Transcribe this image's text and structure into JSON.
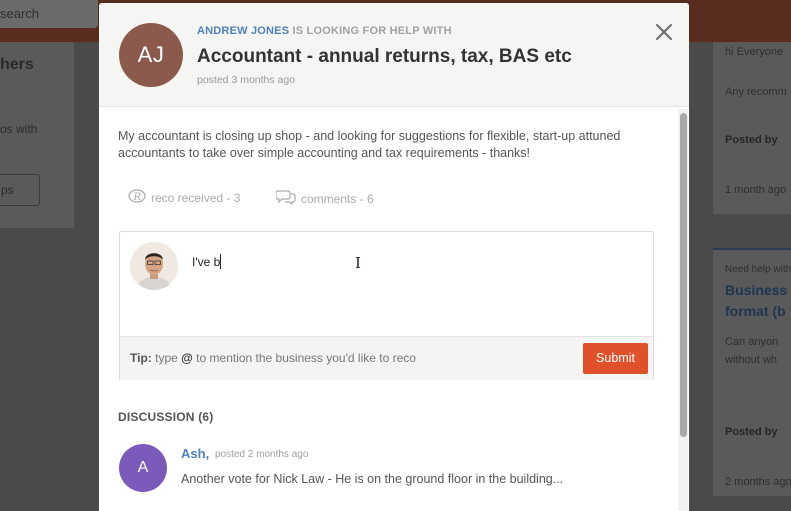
{
  "background": {
    "search_text": "search",
    "left_heading": "hers",
    "left_text": "os with",
    "left_button": "ps",
    "right_text_1": "hi Everyone",
    "right_text_2": "Any recomm",
    "right_posted_by_1": "Posted by",
    "right_time_1": "1 month ago",
    "right_need_help": "Need help with",
    "right_title_1": "Business",
    "right_title_2": "format (b",
    "right_text_3": "Can anyon",
    "right_text_4": "without wh",
    "right_posted_by_2": "Posted by",
    "right_time_2": "2 months ago"
  },
  "modal": {
    "avatar_initials": "AJ",
    "requester_name": "ANDREW JONES",
    "requester_suffix": " IS LOOKING FOR HELP WITH",
    "title": "Accountant - annual returns, tax, BAS etc",
    "posted": "posted 3 months ago",
    "description": "My accountant is closing up shop - and looking for suggestions for flexible, start-up attuned accountants to take over simple accounting and tax requirements - thanks!",
    "stats": {
      "reco_label": "reco received - 3",
      "comments_label": "comments - 6"
    },
    "composer": {
      "value": "I've b",
      "tip_label": "Tip:",
      "tip_pre": " type ",
      "tip_at": "@",
      "tip_post": " to mention the business you'd like to reco",
      "submit_label": "Submit"
    },
    "discussion": {
      "heading": "DISCUSSION (6)",
      "comments": [
        {
          "avatar_initial": "A",
          "author": "Ash",
          "time": "posted 2 months ago",
          "text": "Another vote for Nick Law - He is on the ground floor in the building..."
        }
      ]
    }
  },
  "colors": {
    "accent": "#e0512b",
    "link": "#5080b8",
    "avatar_aj": "#8c5a4c",
    "avatar_comment": "#7a5aba"
  }
}
